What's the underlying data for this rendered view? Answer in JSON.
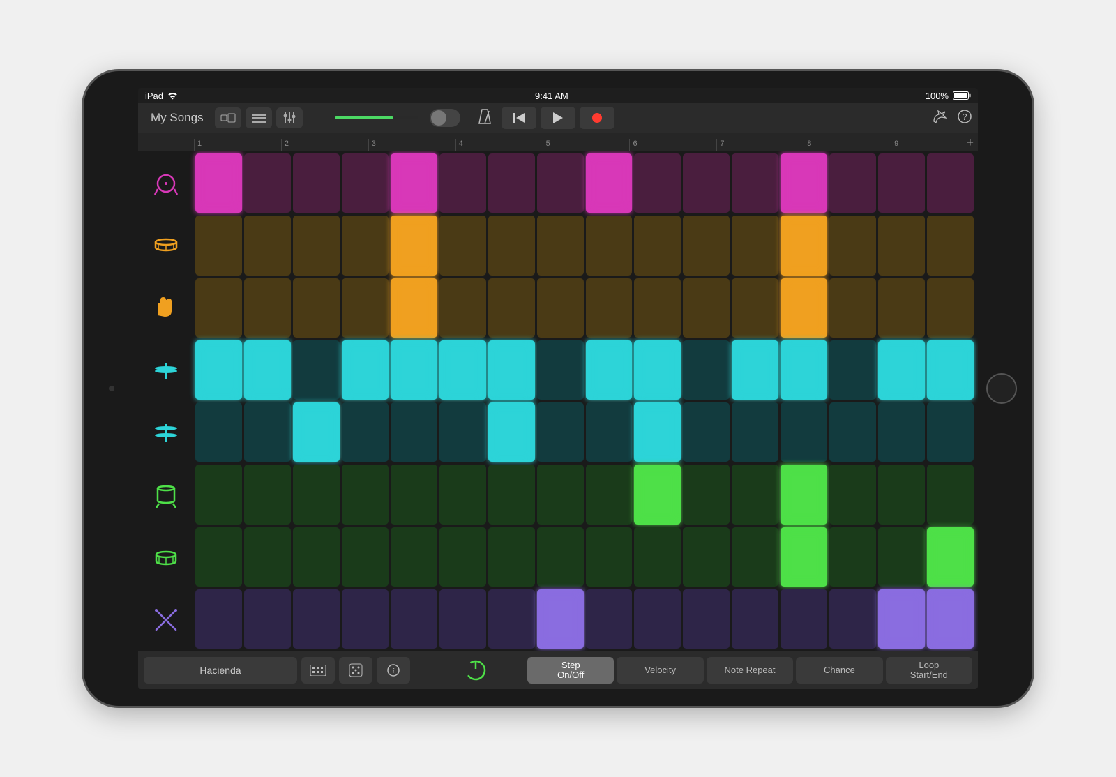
{
  "status": {
    "device": "iPad",
    "time": "9:41 AM",
    "battery": "100%"
  },
  "header": {
    "back_label": "My Songs"
  },
  "ruler": {
    "ticks": [
      "1",
      "2",
      "3",
      "4",
      "5",
      "6",
      "7",
      "8",
      "9"
    ]
  },
  "tracks": [
    {
      "icon": "kick",
      "color": "#d838b8",
      "steps": [
        1,
        0,
        0,
        0,
        1,
        0,
        0,
        0,
        1,
        0,
        0,
        0,
        1,
        0,
        0,
        0
      ]
    },
    {
      "icon": "snare",
      "color": "#f0a020",
      "steps": [
        0,
        0,
        0,
        0,
        1,
        0,
        0,
        0,
        0,
        0,
        0,
        0,
        1,
        0,
        0,
        0
      ]
    },
    {
      "icon": "clap",
      "color": "#f0a020",
      "steps": [
        0,
        0,
        0,
        0,
        1,
        0,
        0,
        0,
        0,
        0,
        0,
        0,
        1,
        0,
        0,
        0
      ]
    },
    {
      "icon": "hihat-c",
      "color": "#2dd4d8",
      "steps": [
        1,
        1,
        0,
        1,
        1,
        1,
        1,
        0,
        1,
        1,
        0,
        1,
        1,
        0,
        1,
        1
      ]
    },
    {
      "icon": "hihat-o",
      "color": "#2dd4d8",
      "steps": [
        0,
        0,
        1,
        0,
        0,
        0,
        1,
        0,
        0,
        1,
        0,
        0,
        0,
        0,
        0,
        0
      ]
    },
    {
      "icon": "tom-f",
      "color": "#4ee048",
      "steps": [
        0,
        0,
        0,
        0,
        0,
        0,
        0,
        0,
        0,
        1,
        0,
        0,
        1,
        0,
        0,
        0
      ]
    },
    {
      "icon": "tom-h",
      "color": "#4ee048",
      "steps": [
        0,
        0,
        0,
        0,
        0,
        0,
        0,
        0,
        0,
        0,
        0,
        0,
        1,
        0,
        0,
        1
      ]
    },
    {
      "icon": "sticks",
      "color": "#8a6de0",
      "steps": [
        0,
        0,
        0,
        0,
        0,
        0,
        0,
        1,
        0,
        0,
        0,
        0,
        0,
        0,
        1,
        1
      ]
    }
  ],
  "footer": {
    "preset": "Hacienda",
    "modes": [
      {
        "label": "Step\nOn/Off",
        "active": true
      },
      {
        "label": "Velocity",
        "active": false
      },
      {
        "label": "Note Repeat",
        "active": false
      },
      {
        "label": "Chance",
        "active": false
      },
      {
        "label": "Loop\nStart/End",
        "active": false
      }
    ]
  }
}
